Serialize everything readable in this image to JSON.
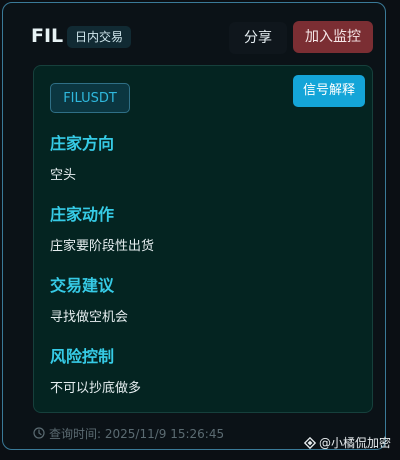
{
  "header": {
    "symbol": "FIL",
    "tag": "日内交易",
    "share_label": "分享",
    "watch_label": "加入监控"
  },
  "panel": {
    "pair": "FILUSDT",
    "explain_label": "信号解释",
    "sections": [
      {
        "title": "庄家方向",
        "text": "空头"
      },
      {
        "title": "庄家动作",
        "text": "庄家要阶段性出货"
      },
      {
        "title": "交易建议",
        "text": "寻找做空机会"
      },
      {
        "title": "风险控制",
        "text": "不可以抄底做多"
      }
    ]
  },
  "footer": {
    "query_time": "查询时间: 2025/11/9 15:26:45",
    "watermark": "@小橘侃加密"
  },
  "colors": {
    "accent": "#36cbe6",
    "watch_button": "#7b2e33",
    "explain_button": "#14a5d8",
    "panel_bg": "#042421"
  },
  "icons": {
    "footer": "clock-icon",
    "watermark": "diamond-logo-icon"
  }
}
